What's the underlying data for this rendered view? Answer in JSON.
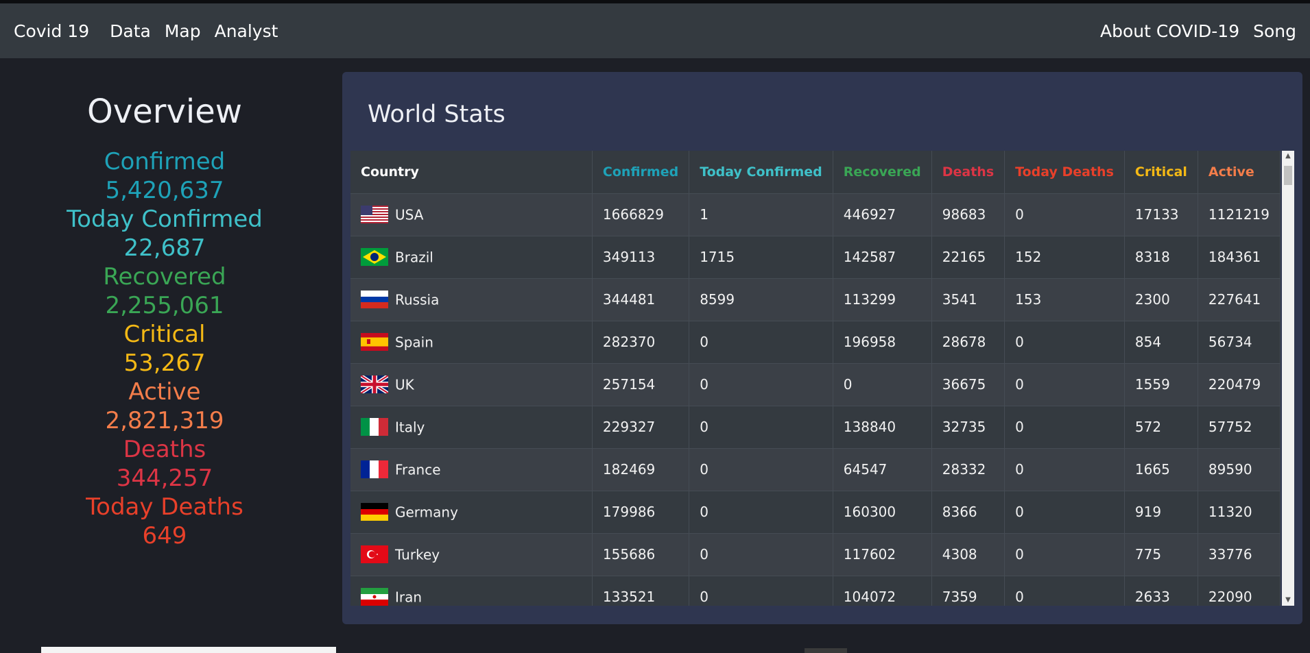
{
  "nav": {
    "brand": "Covid 19",
    "links": [
      "Data",
      "Map",
      "Analyst"
    ],
    "right_links": [
      "About COVID-19",
      "Song"
    ]
  },
  "overview": {
    "title": "Overview",
    "stats": [
      {
        "label": "Confirmed",
        "value": "5,420,637",
        "color": "#1ea2b8"
      },
      {
        "label": "Today Confirmed",
        "value": "22,687",
        "color": "#3fc1c9"
      },
      {
        "label": "Recovered",
        "value": "2,255,061",
        "color": "#3aa655"
      },
      {
        "label": "Critical",
        "value": "53,267",
        "color": "#f5b915"
      },
      {
        "label": "Active",
        "value": "2,821,319",
        "color": "#f47d4a"
      },
      {
        "label": "Deaths",
        "value": "344,257",
        "color": "#dc3545"
      },
      {
        "label": "Today Deaths",
        "value": "649",
        "color": "#e8402a"
      }
    ]
  },
  "world": {
    "title": "World Stats",
    "columns": [
      {
        "label": "Country",
        "color": "#ffffff"
      },
      {
        "label": "Confirmed",
        "color": "#1ea2b8"
      },
      {
        "label": "Today Confirmed",
        "color": "#3fc1c9"
      },
      {
        "label": "Recovered",
        "color": "#3aa655"
      },
      {
        "label": "Deaths",
        "color": "#dc3545"
      },
      {
        "label": "Today Deaths",
        "color": "#e8402a"
      },
      {
        "label": "Critical",
        "color": "#f5b915"
      },
      {
        "label": "Active",
        "color": "#f47d4a"
      }
    ],
    "rows": [
      {
        "country": "USA",
        "flag": "us-flag-icon",
        "cells": [
          "1666829",
          "1",
          "446927",
          "98683",
          "0",
          "17133",
          "1121219"
        ]
      },
      {
        "country": "Brazil",
        "flag": "brazil-flag-icon",
        "cells": [
          "349113",
          "1715",
          "142587",
          "22165",
          "152",
          "8318",
          "184361"
        ]
      },
      {
        "country": "Russia",
        "flag": "russia-flag-icon",
        "cells": [
          "344481",
          "8599",
          "113299",
          "3541",
          "153",
          "2300",
          "227641"
        ]
      },
      {
        "country": "Spain",
        "flag": "spain-flag-icon",
        "cells": [
          "282370",
          "0",
          "196958",
          "28678",
          "0",
          "854",
          "56734"
        ]
      },
      {
        "country": "UK",
        "flag": "uk-flag-icon",
        "cells": [
          "257154",
          "0",
          "0",
          "36675",
          "0",
          "1559",
          "220479"
        ]
      },
      {
        "country": "Italy",
        "flag": "italy-flag-icon",
        "cells": [
          "229327",
          "0",
          "138840",
          "32735",
          "0",
          "572",
          "57752"
        ]
      },
      {
        "country": "France",
        "flag": "france-flag-icon",
        "cells": [
          "182469",
          "0",
          "64547",
          "28332",
          "0",
          "1665",
          "89590"
        ]
      },
      {
        "country": "Germany",
        "flag": "germany-flag-icon",
        "cells": [
          "179986",
          "0",
          "160300",
          "8366",
          "0",
          "919",
          "11320"
        ]
      },
      {
        "country": "Turkey",
        "flag": "turkey-flag-icon",
        "cells": [
          "155686",
          "0",
          "117602",
          "4308",
          "0",
          "775",
          "33776"
        ]
      },
      {
        "country": "Iran",
        "flag": "iran-flag-icon",
        "cells": [
          "133521",
          "0",
          "104072",
          "7359",
          "0",
          "2633",
          "22090"
        ]
      }
    ]
  }
}
